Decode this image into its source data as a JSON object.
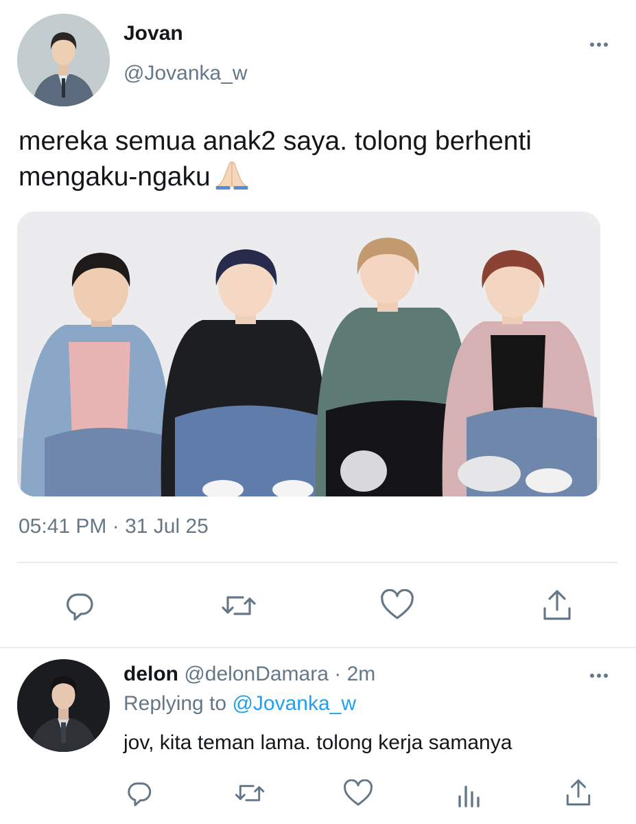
{
  "tweet": {
    "author_name": "Jovan",
    "author_handle": "@Jovanka_w",
    "text": "mereka semua anak2 saya. tolong berhenti mengaku-ngaku",
    "emoji": "folded-hands",
    "timestamp": "05:41 PM · 31 Jul 25",
    "actions": [
      "reply-icon",
      "retweet-icon",
      "like-icon",
      "share-icon"
    ]
  },
  "reply": {
    "author_name": "delon",
    "author_handle": "@delonDamara",
    "separator": "·",
    "time": "2m",
    "replying_prefix": "Replying to",
    "replying_to": "@Jovanka_w",
    "text": "jov, kita teman lama. tolong kerja samanya",
    "actions": [
      "reply-icon",
      "retweet-icon",
      "like-icon",
      "analytics-icon",
      "share-icon"
    ]
  },
  "colors": {
    "text": "#14171a",
    "secondary": "#657786",
    "link": "#1da1f2",
    "divider": "#e6ecf0"
  }
}
